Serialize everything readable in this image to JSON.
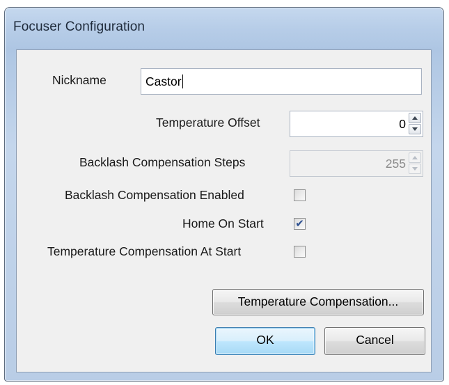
{
  "window": {
    "title": "Focuser Configuration"
  },
  "form": {
    "nickname": {
      "label": "Nickname",
      "value": "Castor"
    },
    "temperature_offset": {
      "label": "Temperature Offset",
      "value": "0"
    },
    "backlash_steps": {
      "label": "Backlash Compensation Steps",
      "value": "255",
      "enabled": false
    },
    "backlash_enabled": {
      "label": "Backlash Compensation Enabled",
      "checked": false
    },
    "home_on_start": {
      "label": "Home On Start",
      "checked": true
    },
    "temp_comp_at_start": {
      "label": "Temperature Compensation At Start",
      "checked": false
    }
  },
  "buttons": {
    "temperature_compensation": "Temperature Compensation...",
    "ok": "OK",
    "cancel": "Cancel"
  },
  "colors": {
    "accent": "#3c7fb1",
    "check": "#2a4d8f"
  }
}
